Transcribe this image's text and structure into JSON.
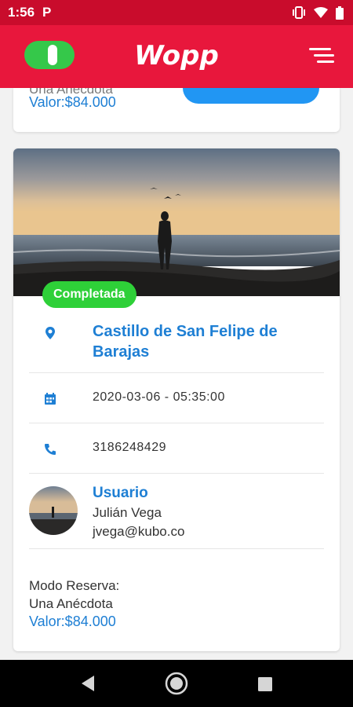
{
  "status_bar": {
    "time": "1:56",
    "notification_icon": "P",
    "icons": [
      "vibrate-icon",
      "wifi-icon",
      "battery-icon"
    ]
  },
  "app_bar": {
    "logo_text": "Wopp",
    "toggle_on": true,
    "menu_icon": "menu-icon",
    "colors": {
      "bar": "#e8173c",
      "status": "#c90c2c",
      "toggle": "#35c84a"
    }
  },
  "previous_card": {
    "ghost_text": "Una Anécdota",
    "valor": "Valor:$84.000"
  },
  "booking": {
    "status": "Completada",
    "place": "Castillo de San Felipe de Barajas",
    "datetime": "2020-03-06 - 05:35:00",
    "phone": "3186248429",
    "user_label": "Usuario",
    "user_name": "Julián Vega",
    "user_email": "jvega@kubo.co",
    "mode_label": "Modo Reserva:",
    "mode_value": "Una Anécdota",
    "valor": "Valor:$84.000"
  },
  "colors": {
    "accent_blue": "#1e7fd4",
    "badge_green": "#2ed038"
  }
}
